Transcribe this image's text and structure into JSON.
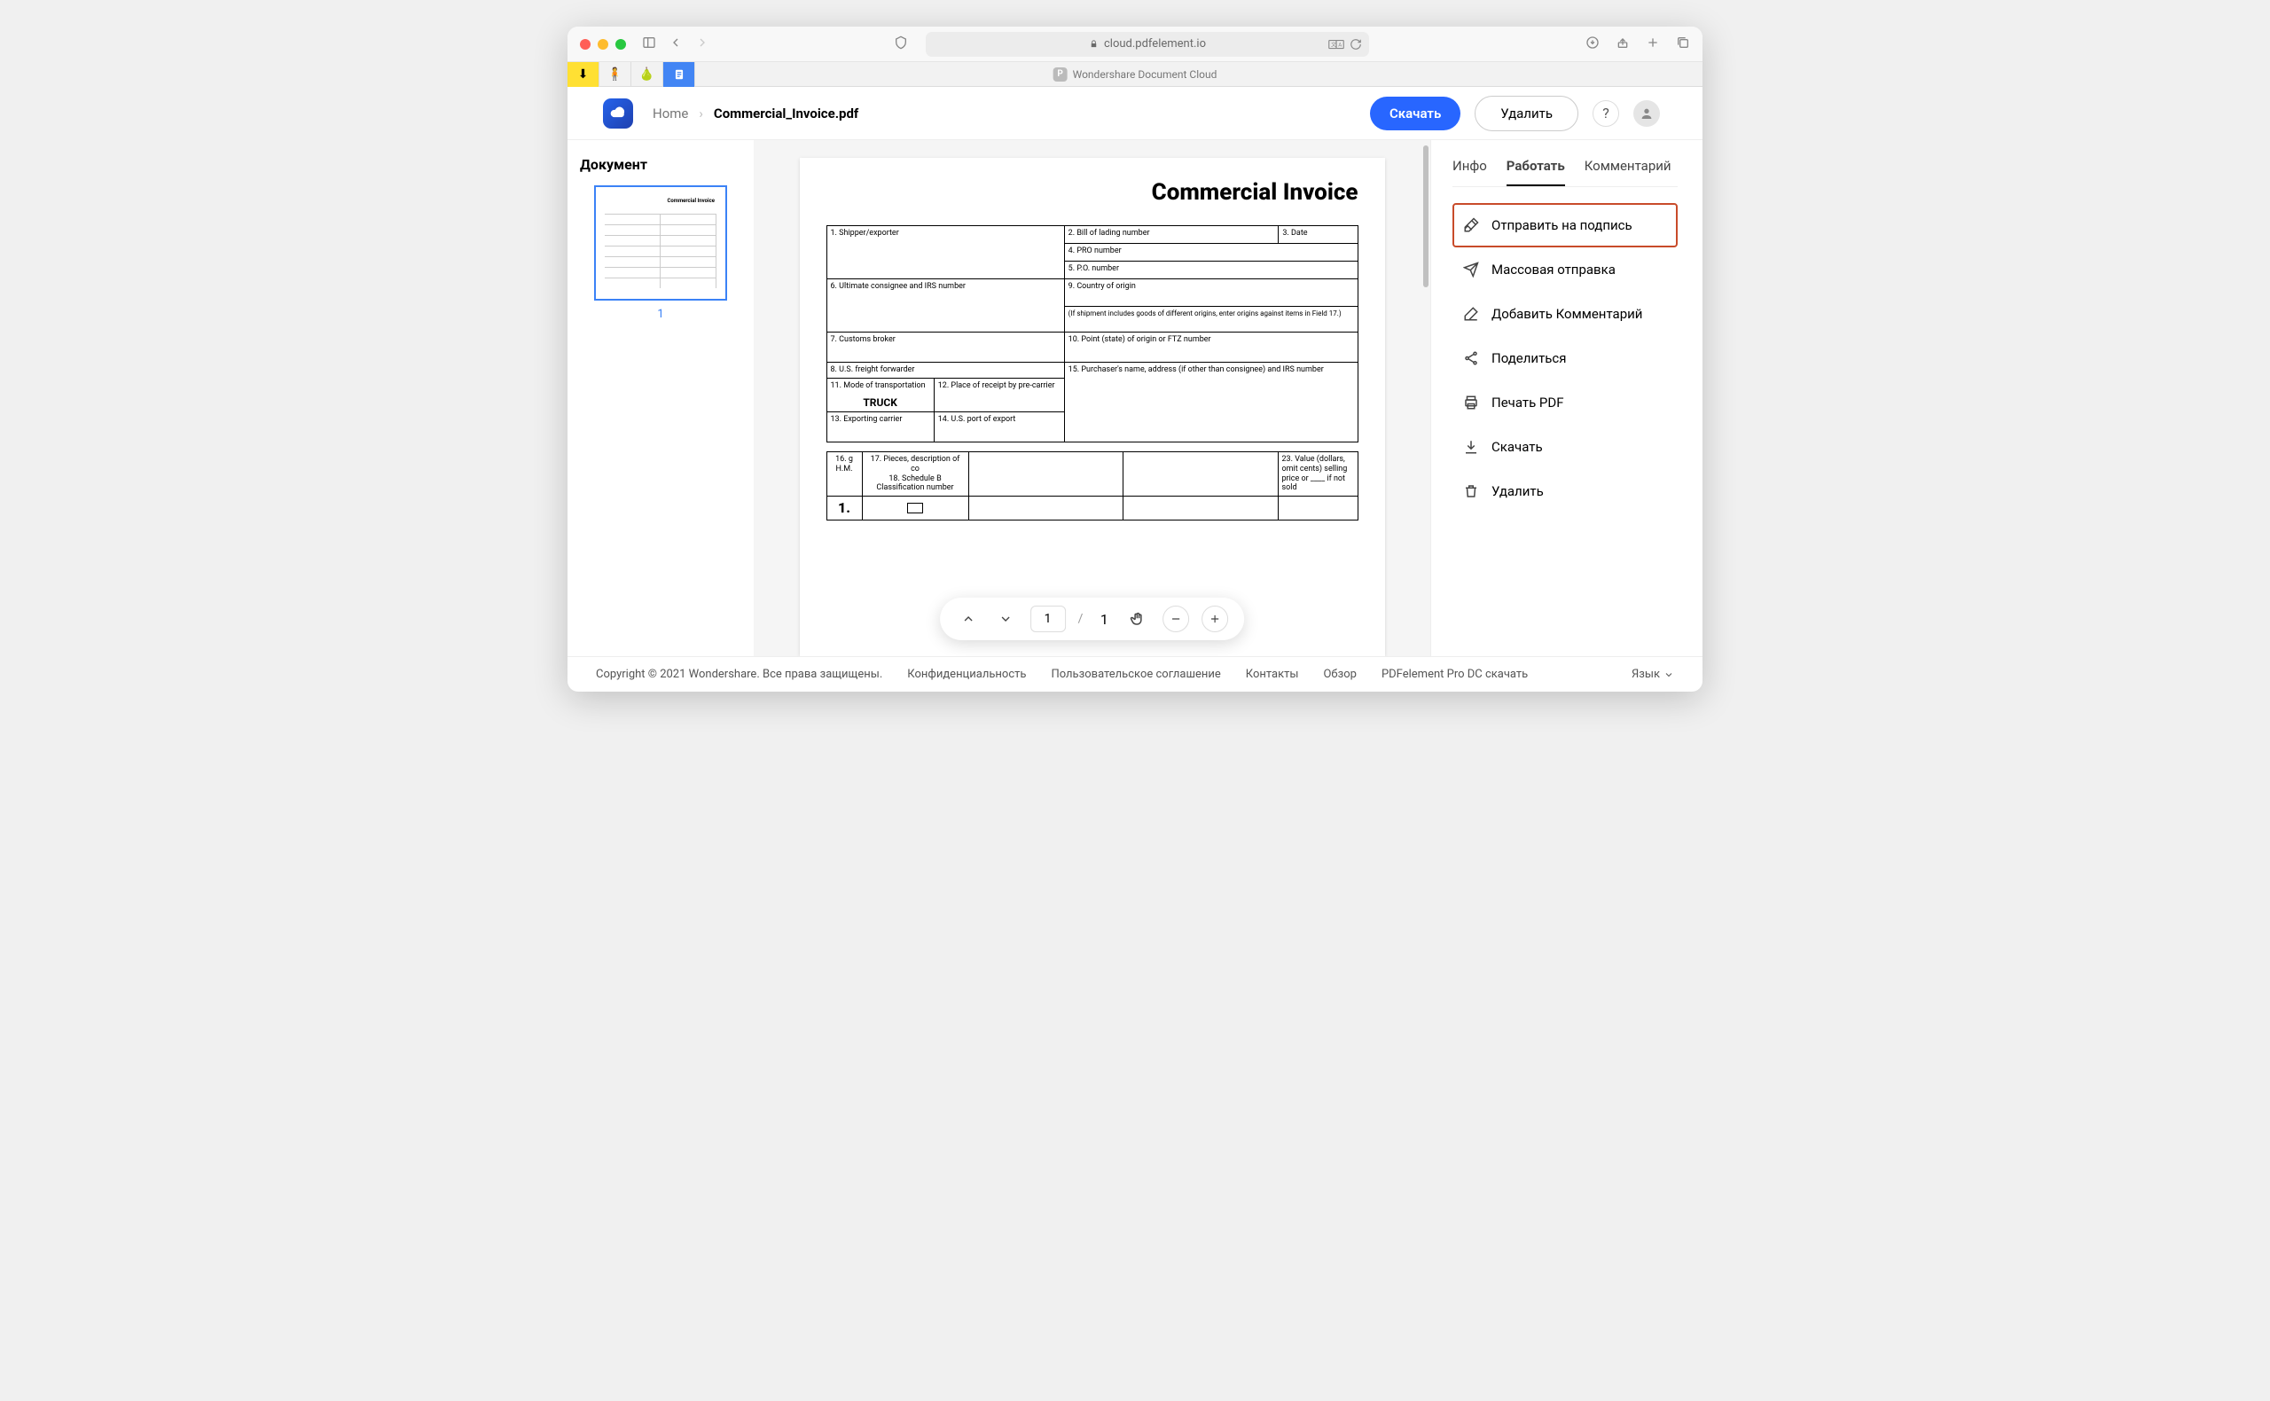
{
  "browser": {
    "url": "cloud.pdfelement.io",
    "tab_title": "Wondershare Document Cloud"
  },
  "header": {
    "breadcrumb_home": "Home",
    "breadcrumb_file": "Commercial_Invoice.pdf",
    "download_btn": "Скачать",
    "delete_btn": "Удалить"
  },
  "left": {
    "title": "Документ",
    "page_number": "1"
  },
  "document": {
    "title": "Commercial Invoice",
    "cells": {
      "c1": "1. Shipper/exporter",
      "c2": "2. Bill of lading number",
      "c3": "3. Date",
      "c4": "4. PRO number",
      "c5": "5. P.O. number",
      "c6": "6. Ultimate consignee and IRS number",
      "c9": "9. Country of origin",
      "c9b": "(If shipment includes goods of different origins, enter origins against items in Field 17.)",
      "c7": "7. Customs broker",
      "c10": "10. Point (state) of origin or FTZ number",
      "c8": "8. U.S. freight forwarder",
      "c15": "15. Purchaser's name, address (if other than consignee) and IRS number",
      "c11": "11. Mode of transportation",
      "c11v": "TRUCK",
      "c12": "12. Place of receipt by pre-carrier",
      "c13": "13. Exporting carrier",
      "c14": "14. U.S. port of export",
      "row2_h1": "16. g H.M.",
      "row2_h2": "17. Pieces, description of co",
      "row2_h3": "18. Schedule B Classification number",
      "row2_h4": "23. Value (dollars, omit cents) selling price or ____ if not sold",
      "big1": "1."
    }
  },
  "viewer": {
    "current_page": "1",
    "total_pages": "1"
  },
  "right": {
    "tabs": {
      "info": "Инфо",
      "work": "Работать",
      "comment": "Комментарий"
    },
    "actions": {
      "sign": "Отправить на подпись",
      "bulk": "Массовая отправка",
      "add_comment": "Добавить Комментарий",
      "share": "Поделиться",
      "print": "Печать PDF",
      "download": "Скачать",
      "delete": "Удалить"
    }
  },
  "footer": {
    "copyright": "Copyright © 2021 Wondershare. Все права защищены.",
    "privacy": "Конфиденциальность",
    "terms": "Пользовательское соглашение",
    "contacts": "Контакты",
    "review": "Обзор",
    "download_pro": "PDFelement Pro DC скачать",
    "language": "Язык"
  }
}
